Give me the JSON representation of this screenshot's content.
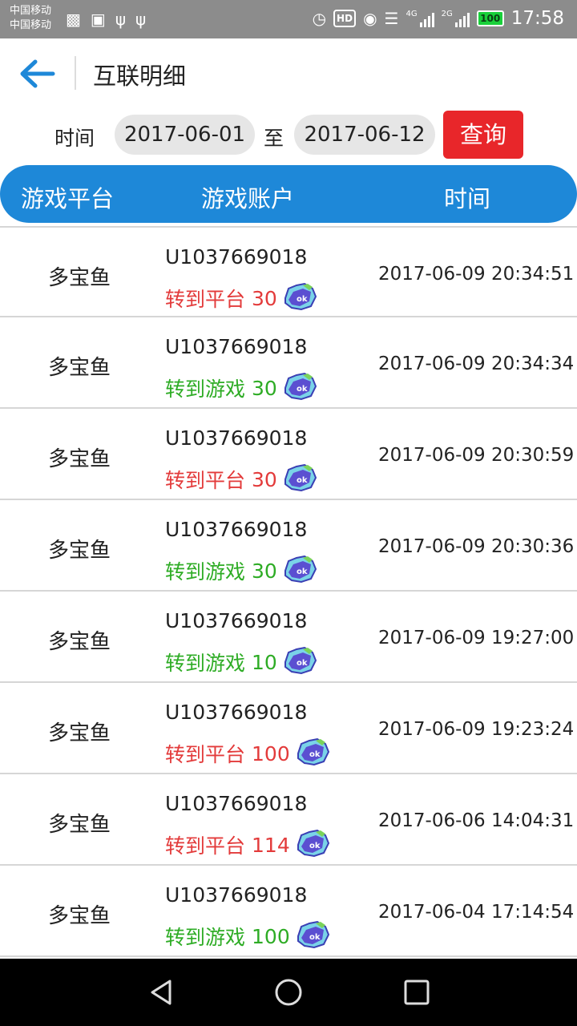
{
  "status_bar": {
    "carrier_1": "中国移动",
    "carrier_2": "中国移动",
    "left_icons": [
      "image-icon",
      "briefcase-icon",
      "usb-icon",
      "usb-icon"
    ],
    "signal_1_label": "4G",
    "signal_2_label": "2G",
    "hd_label": "HD",
    "battery": "100",
    "time": "17:58"
  },
  "app_bar": {
    "title": "互联明细",
    "back_icon": "arrow-left-icon"
  },
  "filter": {
    "label": "时间",
    "date_from": "2017-06-01",
    "to_label": "至",
    "date_to": "2017-06-12",
    "query_label": "查询"
  },
  "table_header": {
    "platform": "游戏平台",
    "account": "游戏账户",
    "time": "时间"
  },
  "rows": [
    {
      "platform": "多宝鱼",
      "account": "U1037669018",
      "action": "转到平台",
      "amount": "30",
      "type": "to-platform",
      "time": "2017-06-09 20:34:51"
    },
    {
      "platform": "多宝鱼",
      "account": "U1037669018",
      "action": "转到游戏",
      "amount": "30",
      "type": "to-game",
      "time": "2017-06-09 20:34:34"
    },
    {
      "platform": "多宝鱼",
      "account": "U1037669018",
      "action": "转到平台",
      "amount": "30",
      "type": "to-platform",
      "time": "2017-06-09 20:30:59"
    },
    {
      "platform": "多宝鱼",
      "account": "U1037669018",
      "action": "转到游戏",
      "amount": "30",
      "type": "to-game",
      "time": "2017-06-09 20:30:36"
    },
    {
      "platform": "多宝鱼",
      "account": "U1037669018",
      "action": "转到游戏",
      "amount": "10",
      "type": "to-game",
      "time": "2017-06-09 19:27:00"
    },
    {
      "platform": "多宝鱼",
      "account": "U1037669018",
      "action": "转到平台",
      "amount": "100",
      "type": "to-platform",
      "time": "2017-06-09 19:23:24"
    },
    {
      "platform": "多宝鱼",
      "account": "U1037669018",
      "action": "转到平台",
      "amount": "114",
      "type": "to-platform",
      "time": "2017-06-06 14:04:31"
    },
    {
      "platform": "多宝鱼",
      "account": "U1037669018",
      "action": "转到游戏",
      "amount": "100",
      "type": "to-game",
      "time": "2017-06-04 17:14:54"
    }
  ],
  "colors": {
    "accent_blue": "#1e88d8",
    "query_red": "#e8262a",
    "to_platform_red": "#e33b3b",
    "to_game_green": "#2eac25"
  },
  "nav_bar": {
    "icons": [
      "nav-back-icon",
      "nav-home-icon",
      "nav-recent-icon"
    ]
  }
}
